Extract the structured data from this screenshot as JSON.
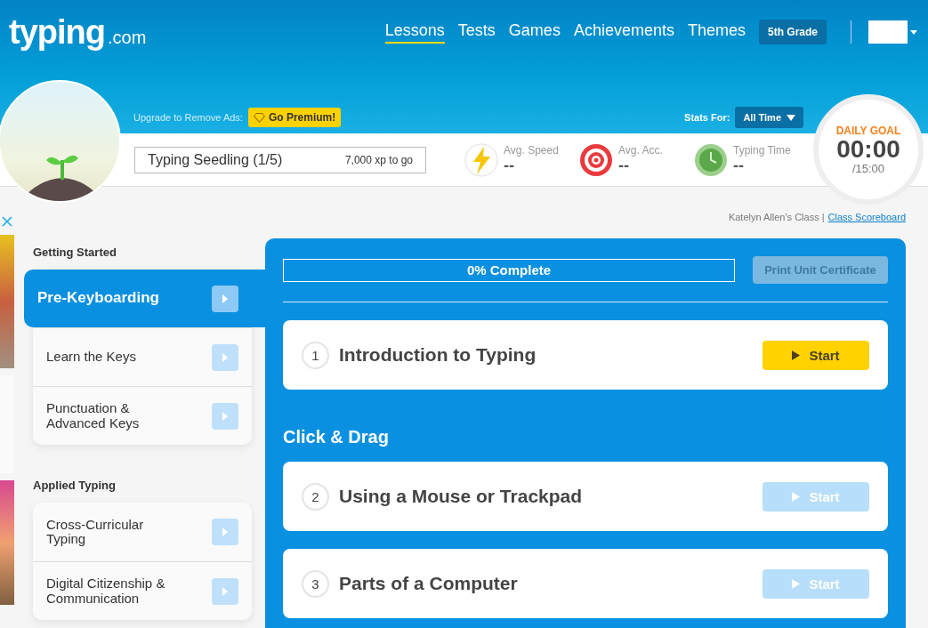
{
  "logo": {
    "name": "typing",
    "suffix": ".com"
  },
  "nav": [
    {
      "label": "Lessons",
      "selected": true
    },
    {
      "label": "Tests",
      "selected": false
    },
    {
      "label": "Games",
      "selected": false
    },
    {
      "label": "Achievements",
      "selected": false
    },
    {
      "label": "Themes",
      "selected": false
    }
  ],
  "grade": "5th Grade",
  "upgrade": {
    "label": "Upgrade to Remove Ads:",
    "button": "Go Premium!"
  },
  "stats_for": {
    "label": "Stats For:",
    "value": "All Time"
  },
  "level": {
    "title": "Typing Seedling (1/5)",
    "xp": "7,000 xp to go"
  },
  "stats": [
    {
      "kind": "speed",
      "label": "Avg. Speed",
      "value": "--"
    },
    {
      "kind": "accuracy",
      "label": "Avg. Acc.",
      "value": "--"
    },
    {
      "kind": "time",
      "label": "Typing Time",
      "value": "--"
    }
  ],
  "daily_goal": {
    "label": "DAILY GOAL",
    "value": "00:00",
    "target": "/15:00"
  },
  "class_info": {
    "name": "Katelyn Allen's Class |",
    "link": "Class Scoreboard"
  },
  "sidebar": [
    {
      "heading": "Getting Started",
      "items": [
        {
          "label": "Pre-Keyboarding",
          "selected": true
        },
        {
          "label": "Learn the Keys",
          "selected": false
        },
        {
          "label": "Punctuation & Advanced Keys",
          "selected": false
        }
      ]
    },
    {
      "heading": "Applied Typing",
      "items": [
        {
          "label": "Cross-Curricular Typing",
          "selected": false
        },
        {
          "label": "Digital Citizenship & Communication",
          "selected": false
        }
      ]
    }
  ],
  "progress": {
    "label": "0% Complete",
    "level": 0
  },
  "certificate_button": {
    "label": "Print Unit Certificate",
    "disabled": true
  },
  "lesson_groups": [
    {
      "lessons": [
        {
          "number": "1",
          "title": "Introduction to Typing",
          "button": "Start",
          "enabled": true
        }
      ]
    },
    {
      "heading": "Click & Drag",
      "lessons": [
        {
          "number": "2",
          "title": "Using a Mouse or Trackpad",
          "button": "Start",
          "enabled": false
        },
        {
          "number": "3",
          "title": "Parts of a Computer",
          "button": "Start",
          "enabled": false
        }
      ]
    }
  ]
}
